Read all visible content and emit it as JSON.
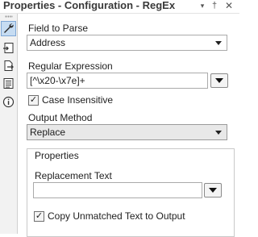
{
  "title_bar": {
    "title": "Properties - Configuration - RegEx",
    "dropdown_icon": "▾",
    "pin_icon": "†",
    "close_icon": "✕"
  },
  "toolbar": {
    "items": [
      {
        "name": "configuration",
        "icon": "wrench-icon",
        "active": true
      },
      {
        "name": "annotation",
        "icon": "annotation-icon",
        "active": false
      },
      {
        "name": "layout",
        "icon": "document-arrow-icon",
        "active": false
      },
      {
        "name": "meta-info",
        "icon": "list-icon",
        "active": false
      },
      {
        "name": "info",
        "icon": "info-icon",
        "active": false
      }
    ]
  },
  "field_to_parse": {
    "label": "Field to Parse",
    "value": "Address"
  },
  "regular_expression": {
    "label": "Regular Expression",
    "value": "[^\\x20-\\x7e]+"
  },
  "case_insensitive": {
    "label": "Case Insensitive",
    "checked": true
  },
  "output_method": {
    "label": "Output Method",
    "value": "Replace"
  },
  "properties_group": {
    "title": "Properties",
    "replacement_text": {
      "label": "Replacement Text",
      "value": ""
    },
    "copy_unmatched": {
      "label": "Copy Unmatched Text to Output",
      "checked": true
    }
  },
  "colors": {
    "active_tool_bg": "#c6dcf2",
    "toolbar_bg": "#f2f2f2",
    "output_select_bg": "#e8e8e8"
  }
}
